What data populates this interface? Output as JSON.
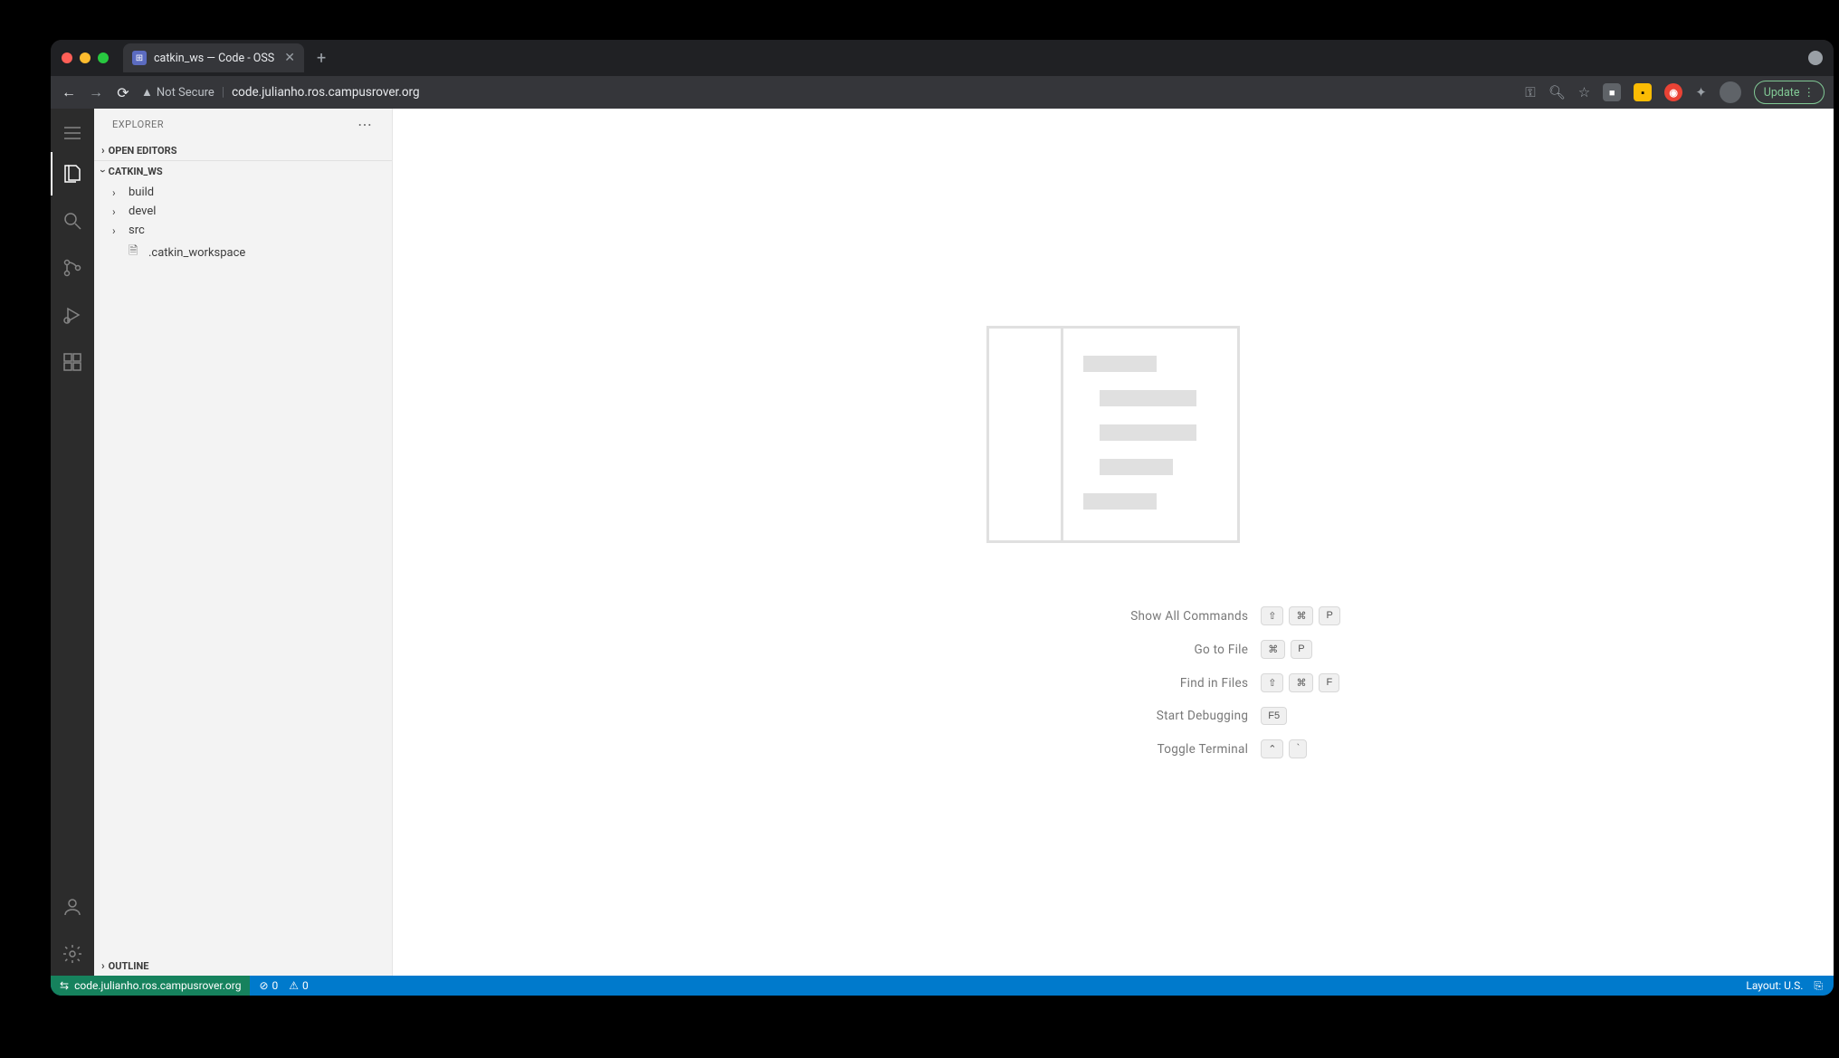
{
  "browser": {
    "tab_title": "catkin_ws — Code - OSS",
    "security_label": "Not Secure",
    "url": "code.julianho.ros.campusrover.org",
    "update_label": "Update"
  },
  "sidebar": {
    "title": "EXPLORER",
    "sections": {
      "open_editors": "OPEN EDITORS",
      "workspace": "CATKIN_WS",
      "outline": "OUTLINE"
    },
    "tree": {
      "items": [
        {
          "label": "build",
          "type": "folder"
        },
        {
          "label": "devel",
          "type": "folder"
        },
        {
          "label": "src",
          "type": "folder"
        },
        {
          "label": ".catkin_workspace",
          "type": "file"
        }
      ]
    }
  },
  "hints": {
    "show_commands": "Show All Commands",
    "go_to_file": "Go to File",
    "find_in_files": "Find in Files",
    "start_debugging": "Start Debugging",
    "toggle_terminal": "Toggle Terminal",
    "keys": {
      "shift": "⇧",
      "cmd": "⌘",
      "ctrl": "⌃",
      "p": "P",
      "f": "F",
      "f5": "F5",
      "backtick": "`"
    }
  },
  "statusbar": {
    "remote": "code.julianho.ros.campusrover.org",
    "errors": "0",
    "warnings": "0",
    "layout": "Layout: U.S."
  }
}
